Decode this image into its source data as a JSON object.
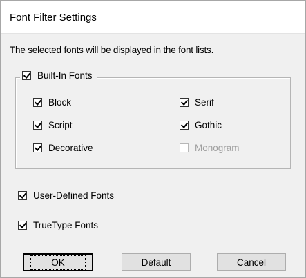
{
  "window": {
    "title": "Font Filter Settings"
  },
  "description": "The selected fonts will be displayed in the font lists.",
  "built_in": {
    "label": "Built-In Fonts",
    "checked": true,
    "options": [
      {
        "label": "Block",
        "checked": true,
        "enabled": true
      },
      {
        "label": "Serif",
        "checked": true,
        "enabled": true
      },
      {
        "label": "Script",
        "checked": true,
        "enabled": true
      },
      {
        "label": "Gothic",
        "checked": true,
        "enabled": true
      },
      {
        "label": "Decorative",
        "checked": true,
        "enabled": true
      },
      {
        "label": "Monogram",
        "checked": false,
        "enabled": false
      }
    ]
  },
  "user_defined": {
    "label": "User-Defined Fonts",
    "checked": true
  },
  "truetype": {
    "label": "TrueType Fonts",
    "checked": true
  },
  "buttons": {
    "ok": "OK",
    "default": "Default",
    "cancel": "Cancel"
  },
  "icons": {
    "checkbox_checked": "checkmark-icon"
  },
  "colors": {
    "dialog_bg": "#f0f0f0",
    "titlebar_bg": "#ffffff",
    "disabled_text": "#a0a0a0"
  }
}
